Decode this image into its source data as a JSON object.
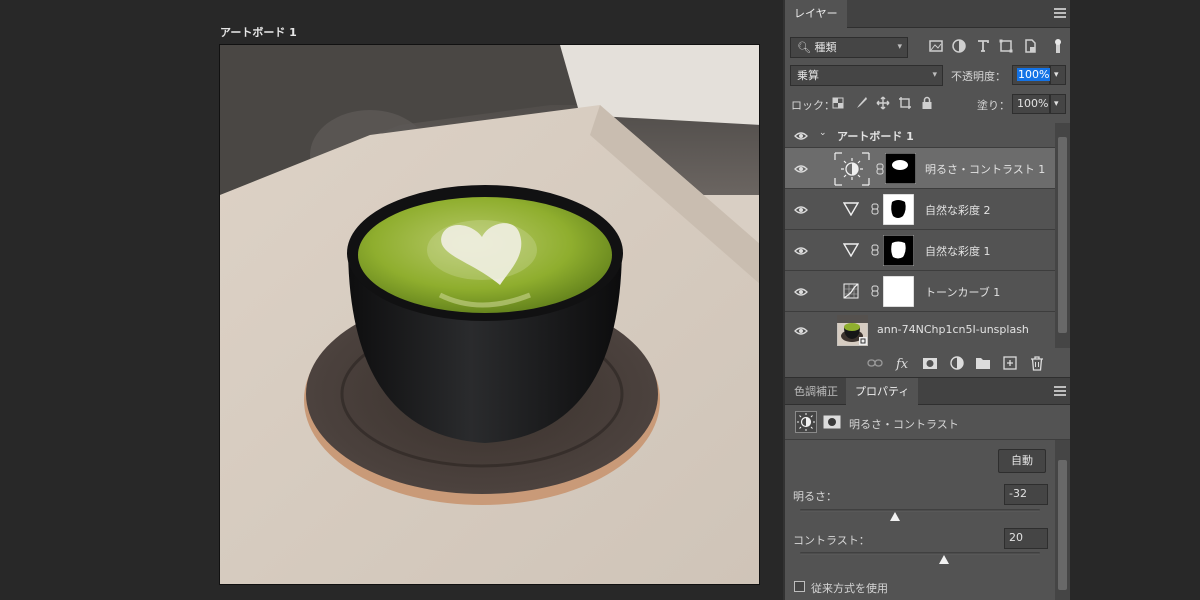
{
  "canvas": {
    "artboard_label": "アートボード 1"
  },
  "layers_panel": {
    "tab_label": "レイヤー",
    "filter_kind": "種類",
    "blend_mode": "乗算",
    "opacity_label": "不透明度：",
    "opacity_value": "100%",
    "lock_label": "ロック：",
    "fill_label": "塗り：",
    "fill_value": "100%",
    "artboard_group": "アートボード 1",
    "layers": [
      {
        "name": "明るさ・コントラスト 1",
        "type": "brightness-contrast",
        "selected": true
      },
      {
        "name": "自然な彩度 2",
        "type": "vibrance",
        "selected": false
      },
      {
        "name": "自然な彩度 1",
        "type": "vibrance",
        "selected": false
      },
      {
        "name": "トーンカーブ 1",
        "type": "curves",
        "selected": false
      },
      {
        "name": "ann-74NChp1cn5I-unsplash",
        "type": "smart-object",
        "selected": false
      }
    ]
  },
  "properties_panel": {
    "tab_adjustments": "色調補正",
    "tab_properties": "プロパティ",
    "adjustment_title": "明るさ・コントラスト",
    "auto_button": "自動",
    "brightness_label": "明るさ：",
    "brightness_value": "-32",
    "brightness_fraction": 0.395,
    "contrast_label": "コントラスト：",
    "contrast_value": "20",
    "contrast_fraction": 0.6,
    "legacy_label": "従来方式を使用",
    "legacy_checked": false
  },
  "colors": {
    "panel_bg": "#535353",
    "tab_bg": "#424242",
    "selection_highlight": "#1473e6",
    "canvas_bg": "#282828"
  }
}
